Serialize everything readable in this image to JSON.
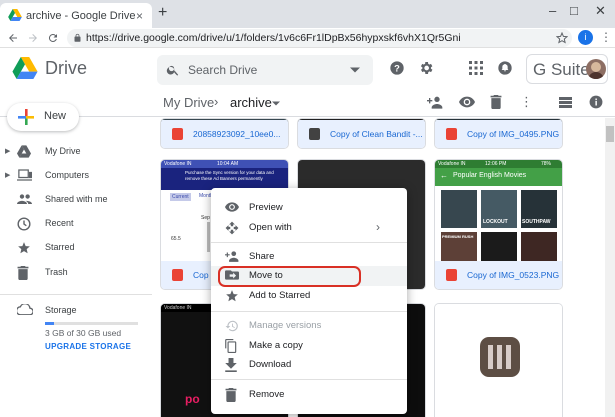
{
  "browser": {
    "tab_title": "archive - Google Drive",
    "new_tab": "+",
    "close_tab": "×",
    "url": "https://drive.google.com/drive/u/1/folders/1v6c6Fr1lDpBx56hypxskf6vhX1Qr5Gni",
    "profile_initial": "i"
  },
  "drive": {
    "app_name": "Drive",
    "search_placeholder": "Search Drive",
    "gsuite_label": "G Suite"
  },
  "breadcrumb": {
    "root": "My Drive",
    "separator": "›",
    "current": "archive"
  },
  "sidebar": {
    "new_label": "New",
    "items": [
      {
        "label": "My Drive",
        "icon": "drive-folder-icon"
      },
      {
        "label": "Computers",
        "icon": "computer-icon"
      },
      {
        "label": "Shared with me",
        "icon": "people-icon"
      },
      {
        "label": "Recent",
        "icon": "clock-icon"
      },
      {
        "label": "Starred",
        "icon": "star-icon"
      },
      {
        "label": "Trash",
        "icon": "trash-icon"
      }
    ],
    "storage_label": "Storage",
    "storage_used": "3 GB of 30 GB used",
    "storage_fraction": 0.1,
    "upgrade_label": "UPGRADE STORAGE"
  },
  "files": [
    {
      "name": "20858923092_10ee0..."
    },
    {
      "name": "Copy of Clean Bandit -..."
    },
    {
      "name": "Copy of IMG_0495.PNG"
    },
    {
      "name": "Cop"
    },
    {
      "name": "Copy of IMG_0523.PNG"
    }
  ],
  "thumb_text": {
    "status_carrier": "Vodafone IN",
    "status_time_1": "10:04 AM",
    "status_time_2": "12:06 PM",
    "battery": "78%",
    "sync_notice": "Purchase the Sync version for your data and remove these Ad Banners permanently",
    "tab_current": "Current",
    "tab_monthly": "Month",
    "chart_num": "65.5",
    "chart_label": "Sep",
    "movies_title": "Popular English Movies",
    "movie_1": "LOCKOUT",
    "movie_2": "SOUTHPAW",
    "movie_3": "PREMIUM RUSH",
    "poster_text": "po"
  },
  "context_menu": {
    "items": [
      {
        "label": "Preview",
        "icon": "eye-icon"
      },
      {
        "label": "Open with",
        "icon": "open-with-icon",
        "submenu": "›"
      },
      {
        "label": "Share",
        "icon": "share-person-icon"
      },
      {
        "label": "Move to",
        "icon": "move-to-folder-icon"
      },
      {
        "label": "Add to Starred",
        "icon": "star-icon"
      },
      {
        "label": "Manage versions",
        "icon": "history-icon",
        "disabled": true
      },
      {
        "label": "Make a copy",
        "icon": "copy-icon"
      },
      {
        "label": "Download",
        "icon": "download-icon"
      },
      {
        "label": "Remove",
        "icon": "trash-icon"
      }
    ]
  },
  "colors": {
    "accent_blue": "#1a73e8",
    "highlight_red": "#d93025",
    "image_icon_red": "#ea4335"
  }
}
